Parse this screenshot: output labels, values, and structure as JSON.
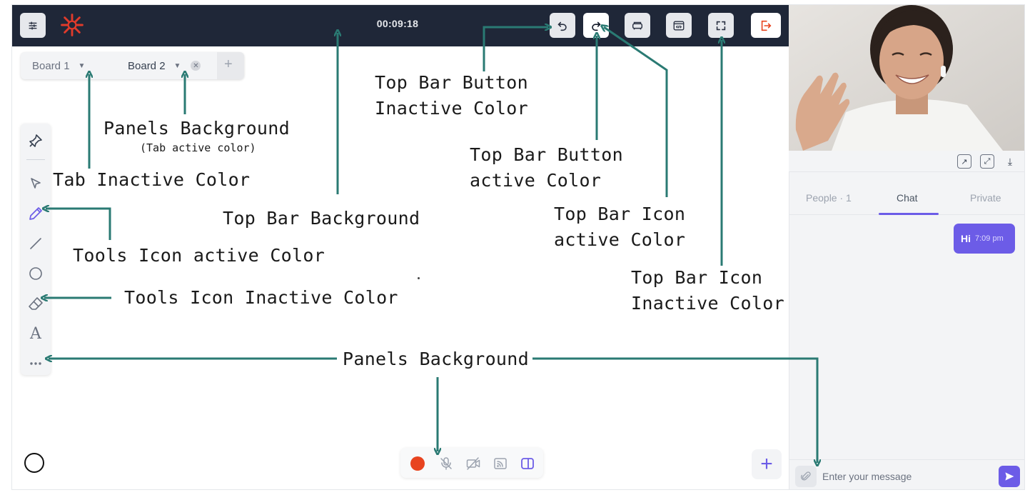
{
  "topbar": {
    "timer": "00:09:18",
    "buttons": [
      {
        "name": "undo",
        "icon": "undo-icon",
        "state": "inactive"
      },
      {
        "name": "redo",
        "icon": "redo-icon",
        "state": "active"
      },
      {
        "name": "board-view",
        "icon": "sofa-icon",
        "state": "inactive"
      },
      {
        "name": "embed",
        "icon": "code-window-icon",
        "state": "inactive"
      },
      {
        "name": "fullscreen",
        "icon": "fullscreen-icon",
        "state": "inactive"
      },
      {
        "name": "exit",
        "icon": "exit-icon",
        "state": "inactive"
      }
    ]
  },
  "tabs": {
    "items": [
      {
        "label": "Board 1",
        "active": false
      },
      {
        "label": "Board 2",
        "active": true
      }
    ],
    "add": "+"
  },
  "tools": {
    "items": [
      "pin-icon",
      "select-icon",
      "pen-icon",
      "line-icon",
      "circle-icon",
      "eraser-icon",
      "text-icon",
      "more-icon"
    ],
    "active": "pen-icon",
    "text_glyph": "A"
  },
  "chat": {
    "tabs": [
      "People · 1",
      "Chat",
      "Private"
    ],
    "active_tab": "Chat",
    "messages": [
      {
        "text": "Hi",
        "time": "7:09 pm"
      }
    ],
    "input_placeholder": "Enter your message"
  },
  "annotations": {
    "panels_bg_tab": "Panels Background",
    "panels_bg_tab_sub": "(Tab active color)",
    "tab_inactive": "Tab Inactive Color",
    "topbar_btn_inactive_1": "Top Bar Button",
    "topbar_btn_inactive_2": "Inactive Color",
    "topbar_bg": "Top Bar Background",
    "topbar_btn_active_1": "Top Bar Button",
    "topbar_btn_active_2": "active Color",
    "topbar_icon_active_1": "Top Bar Icon",
    "topbar_icon_active_2": "active Color",
    "topbar_icon_inactive_1": "Top Bar Icon",
    "topbar_icon_inactive_2": "Inactive Color",
    "tools_active": "Tools Icon active Color",
    "tools_inactive": "Tools Icon Inactive Color",
    "panels_bg": "Panels Background"
  },
  "colors": {
    "topbar_bg": "#1f2738",
    "accent": "#6c5ce7",
    "record": "#e8441f",
    "annotation_arrow": "#2a7a73"
  }
}
